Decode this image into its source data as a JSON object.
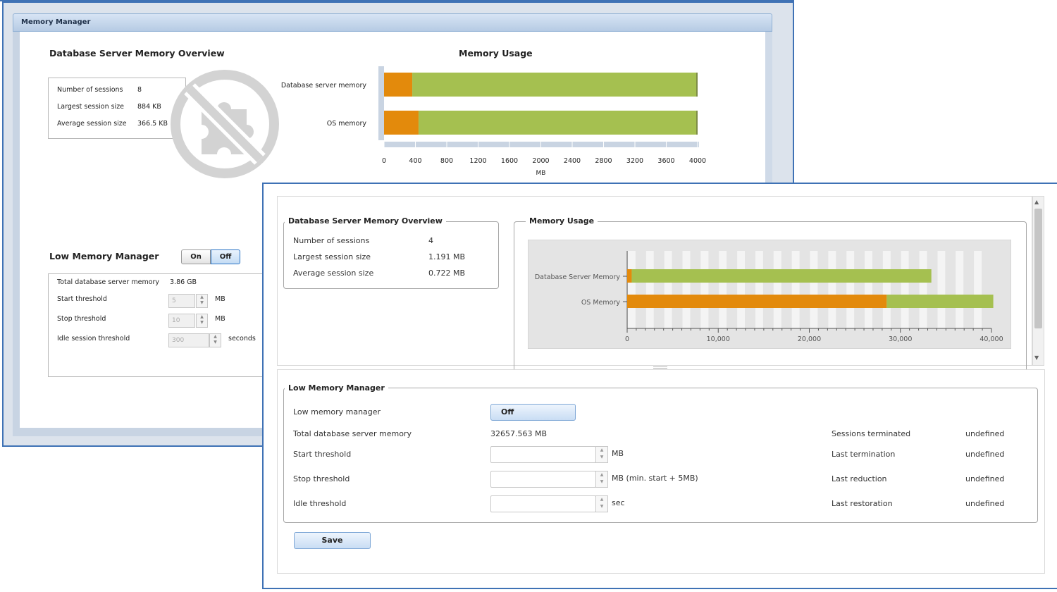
{
  "old_window": {
    "title": "Memory Manager",
    "overview": {
      "heading": "Database Server Memory Overview",
      "rows": [
        {
          "label": "Number of sessions",
          "value": "8"
        },
        {
          "label": "Largest session size",
          "value": "884 KB"
        },
        {
          "label": "Average session size",
          "value": "366.5 KB"
        }
      ]
    },
    "blocked_plugin_icon": "puzzle-blocked-icon",
    "chart_heading": "Memory Usage",
    "low_memory": {
      "heading": "Low Memory Manager",
      "on_label": "On",
      "off_label": "Off",
      "selected": "Off",
      "total_label": "Total database server memory",
      "total_value": "3.86 GB",
      "start_label": "Start threshold",
      "start_value": "5",
      "start_unit": "MB",
      "stop_label": "Stop threshold",
      "stop_value": "10",
      "stop_unit": "MB",
      "idle_label": "Idle session threshold",
      "idle_value": "300",
      "idle_unit": "seconds"
    }
  },
  "new_window": {
    "overview": {
      "legend": "Database Server Memory Overview",
      "rows": [
        {
          "label": "Number of sessions",
          "value": "4"
        },
        {
          "label": "Largest session size",
          "value": "1.191 MB"
        },
        {
          "label": "Average session size",
          "value": "0.722 MB"
        }
      ]
    },
    "chart_legend": "Memory Usage",
    "low_memory": {
      "legend": "Low Memory Manager",
      "toggle_label": "Low memory manager",
      "toggle_value": "Off",
      "total_label": "Total database server memory",
      "total_value": "32657.563 MB",
      "start_label": "Start threshold",
      "start_value": "",
      "start_unit": "MB",
      "stop_label": "Stop threshold",
      "stop_value": "",
      "stop_unit": "MB (min. start + 5MB)",
      "idle_label": "Idle threshold",
      "idle_value": "",
      "idle_unit": "sec",
      "stats": [
        {
          "label": "Sessions terminated",
          "value": "undefined"
        },
        {
          "label": "Last termination",
          "value": "undefined"
        },
        {
          "label": "Last reduction",
          "value": "undefined"
        },
        {
          "label": "Last restoration",
          "value": "undefined"
        }
      ],
      "save_label": "Save"
    }
  },
  "colors": {
    "used": "#e38a0c",
    "free": "#a5c050",
    "window_border": "#3f72b5"
  },
  "chart_data": [
    {
      "type": "bar",
      "orientation": "horizontal",
      "stacked": true,
      "title": "Memory Usage",
      "categories": [
        "Database server memory",
        "OS memory"
      ],
      "series": [
        {
          "values": [
            360,
            440
          ]
        },
        {
          "values": [
            3640,
            3560
          ]
        }
      ],
      "xlabel": "MB",
      "xlim": [
        0,
        4000
      ],
      "xticks": [
        0,
        400,
        800,
        1200,
        1600,
        2000,
        2400,
        2800,
        3200,
        3600,
        4000
      ]
    },
    {
      "type": "bar",
      "orientation": "horizontal",
      "stacked": true,
      "title": "Memory Usage",
      "categories": [
        "Database Server Memory",
        "OS Memory"
      ],
      "series": [
        {
          "values": [
            500,
            28500
          ]
        },
        {
          "values": [
            32900,
            11700
          ]
        }
      ],
      "xlim": [
        0,
        40000
      ],
      "xticks": [
        0,
        10000,
        20000,
        30000,
        40000
      ],
      "xtick_labels": [
        "0",
        "10,000",
        "20,000",
        "30,000",
        "40,000"
      ]
    }
  ]
}
